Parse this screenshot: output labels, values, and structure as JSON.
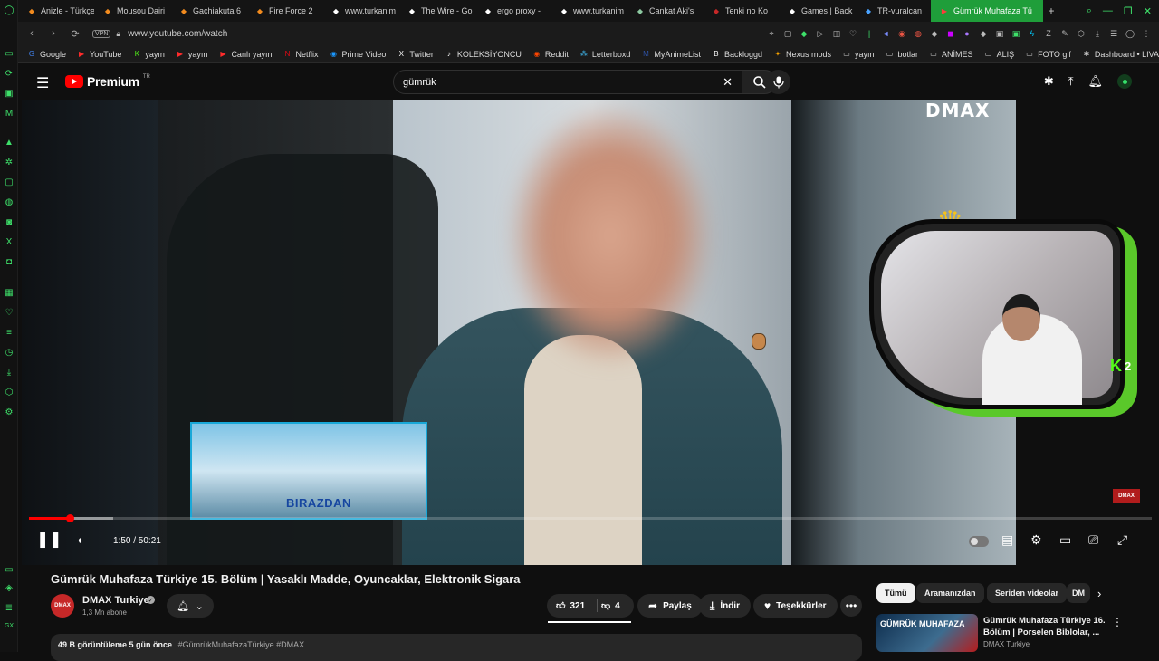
{
  "browser": {
    "tabs": [
      {
        "label": "Anizle - Türkçe",
        "icon": "anime-icon",
        "color": "#f28b1e"
      },
      {
        "label": "Mousou Dairi",
        "icon": "anime-icon",
        "color": "#f28b1e"
      },
      {
        "label": "Gachiakuta 6",
        "icon": "anime-icon",
        "color": "#f28b1e"
      },
      {
        "label": "Fire Force 2",
        "icon": "anime-icon",
        "color": "#f28b1e"
      },
      {
        "label": "www.turkanim",
        "icon": "page-icon",
        "color": "#ffffff"
      },
      {
        "label": "The Wire - Go",
        "icon": "google-icon",
        "color": "#ffffff"
      },
      {
        "label": "ergo proxy - ",
        "icon": "google-icon",
        "color": "#ffffff"
      },
      {
        "label": "www.turkanim",
        "icon": "page-icon",
        "color": "#ffffff"
      },
      {
        "label": "Cankat Aki's ",
        "icon": "twitch-icon",
        "color": "#8cc8a0"
      },
      {
        "label": "Tenki no Ko ",
        "icon": "video-icon",
        "color": "#c62828"
      },
      {
        "label": "Games | Back",
        "icon": "backloggd-icon",
        "color": "#ffffff"
      },
      {
        "label": "TR-vuralcan",
        "icon": "chat-icon",
        "color": "#4aa3ff"
      }
    ],
    "active_tab": {
      "label": "Gümrük Muhafaza Tü",
      "icon": "youtube-icon"
    },
    "new_tab": "+",
    "url": "www.youtube.com/watch",
    "vpn_label": "VPN",
    "bookmarks": [
      {
        "label": "Google",
        "icon": "google-icon"
      },
      {
        "label": "YouTube",
        "icon": "youtube-icon"
      },
      {
        "label": "yayın",
        "icon": "kick-icon"
      },
      {
        "label": "yayın",
        "icon": "youtube-icon"
      },
      {
        "label": "Canlı yayın",
        "icon": "youtube-icon"
      },
      {
        "label": "Netflix",
        "icon": "netflix-icon"
      },
      {
        "label": "Prime Video",
        "icon": "prime-icon"
      },
      {
        "label": "Twitter",
        "icon": "x-icon"
      },
      {
        "label": "KOLEKSİYONCU",
        "icon": "tiktok-icon"
      },
      {
        "label": "Reddit",
        "icon": "reddit-icon"
      },
      {
        "label": "Letterboxd",
        "icon": "letterboxd-icon"
      },
      {
        "label": "MyAnimeList",
        "icon": "mal-icon"
      },
      {
        "label": "Backloggd",
        "icon": "backloggd-icon"
      },
      {
        "label": "Nexus mods",
        "icon": "nexus-icon"
      },
      {
        "label": "yayın",
        "icon": "folder-icon"
      },
      {
        "label": "botlar",
        "icon": "folder-icon"
      },
      {
        "label": "ANİMES",
        "icon": "folder-icon"
      },
      {
        "label": "ALIŞ",
        "icon": "folder-icon"
      },
      {
        "label": "FOTO gif",
        "icon": "folder-icon"
      },
      {
        "label": "Dashboard • LIVAD",
        "icon": "livad-icon"
      }
    ]
  },
  "youtube": {
    "brand": "Premium",
    "region": "TR",
    "search_value": "gümrük",
    "player": {
      "channel_logo": "DMAX",
      "corner_logo": "DMAX",
      "preview_text": "BIRAZDAN",
      "current_time": "1:50",
      "duration": "50:21",
      "time_display": "1:50 / 50:21",
      "progress_fraction": 0.0364,
      "buffer_fraction": 0.075,
      "overlay_badge": "2"
    },
    "video": {
      "title": "Gümrük Muhafaza Türkiye 15. Bölüm | Yasaklı Madde, Oyuncaklar, Elektronik Sigara",
      "channel": "DMAX Turkiye",
      "channel_avatar_text": "DMAX",
      "subscribers": "1,3 Mn abone",
      "likes": "321",
      "dislikes": "4",
      "share": "Paylaş",
      "download": "İndir",
      "thanks": "Teşekkürler",
      "views": "49 B görüntüleme",
      "age": "5 gün önce",
      "tags": "#GümrükMuhafazaTürkiye #DMAX"
    },
    "chips": [
      "Tümü",
      "Aramanızdan",
      "Seriden videolar",
      "DM"
    ],
    "recommendation": {
      "thumb_text": "GÜMRÜK MUHAFAZA",
      "title": "Gümrük Muhafaza Türkiye 16. Bölüm | Porselen Biblolar, ...",
      "channel": "DMAX Turkiye"
    }
  },
  "colors": {
    "accent": "#ff0000",
    "opera_green": "#3ee06a",
    "active_tab": "#1f9e3a"
  }
}
